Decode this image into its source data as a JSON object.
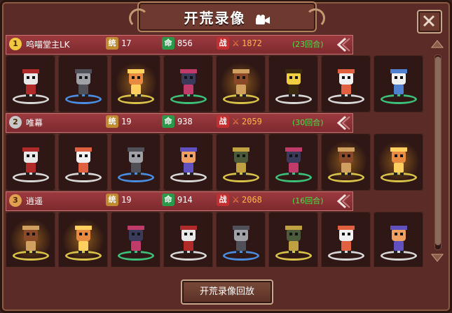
{
  "window": {
    "title": "开荒录像"
  },
  "stat_icons": {
    "command": "统",
    "life": "命",
    "battle": "战"
  },
  "records": [
    {
      "rank": "1",
      "name": "呜喵堂主LK",
      "command": "17",
      "life": "856",
      "power": "1872",
      "rounds": "(23回合)",
      "units": [
        {
          "ring": "white",
          "glow": false,
          "name": "panda-red-hat"
        },
        {
          "ring": "blue",
          "glow": false,
          "name": "grey-raccoon"
        },
        {
          "ring": "gold",
          "glow": true,
          "name": "fire-cat"
        },
        {
          "ring": "green",
          "glow": false,
          "name": "horned-mask"
        },
        {
          "ring": "gold",
          "glow": true,
          "name": "boar-beast"
        },
        {
          "ring": "white",
          "glow": false,
          "name": "yellow-block"
        },
        {
          "ring": "white",
          "glow": false,
          "name": "fox-mask"
        },
        {
          "ring": "green",
          "glow": false,
          "name": "white-cat"
        }
      ]
    },
    {
      "rank": "2",
      "name": "唯幕",
      "command": "19",
      "life": "938",
      "power": "2059",
      "rounds": "(30回合)",
      "units": [
        {
          "ring": "white",
          "glow": false,
          "name": "panda-red-hat"
        },
        {
          "ring": "white",
          "glow": false,
          "name": "fox-mask"
        },
        {
          "ring": "blue",
          "glow": false,
          "name": "grey-raccoon"
        },
        {
          "ring": "white",
          "glow": false,
          "name": "orange-girl"
        },
        {
          "ring": "gold",
          "glow": false,
          "name": "green-soldier"
        },
        {
          "ring": "green",
          "glow": false,
          "name": "horned-mask"
        },
        {
          "ring": "gold",
          "glow": true,
          "name": "boar-beast"
        },
        {
          "ring": "gold",
          "glow": true,
          "name": "fire-cat"
        }
      ]
    },
    {
      "rank": "3",
      "name": "逍遥",
      "command": "19",
      "life": "914",
      "power": "2068",
      "rounds": "(16回合)",
      "units": [
        {
          "ring": "gold",
          "glow": true,
          "name": "boar-beast"
        },
        {
          "ring": "gold",
          "glow": true,
          "name": "fire-cat"
        },
        {
          "ring": "green",
          "glow": false,
          "name": "horned-mask"
        },
        {
          "ring": "white",
          "glow": false,
          "name": "panda-red-hat"
        },
        {
          "ring": "blue",
          "glow": false,
          "name": "grey-raccoon"
        },
        {
          "ring": "gold",
          "glow": false,
          "name": "green-soldier"
        },
        {
          "ring": "white",
          "glow": false,
          "name": "fox-mask"
        },
        {
          "ring": "white",
          "glow": false,
          "name": "orange-girl"
        }
      ]
    }
  ],
  "footer": {
    "replay_label": "开荒录像回放"
  },
  "colors": {
    "gold": "#d9c24a",
    "blue": "#4a8de0",
    "green": "#3cc07a",
    "white": "#d8d8d8"
  }
}
